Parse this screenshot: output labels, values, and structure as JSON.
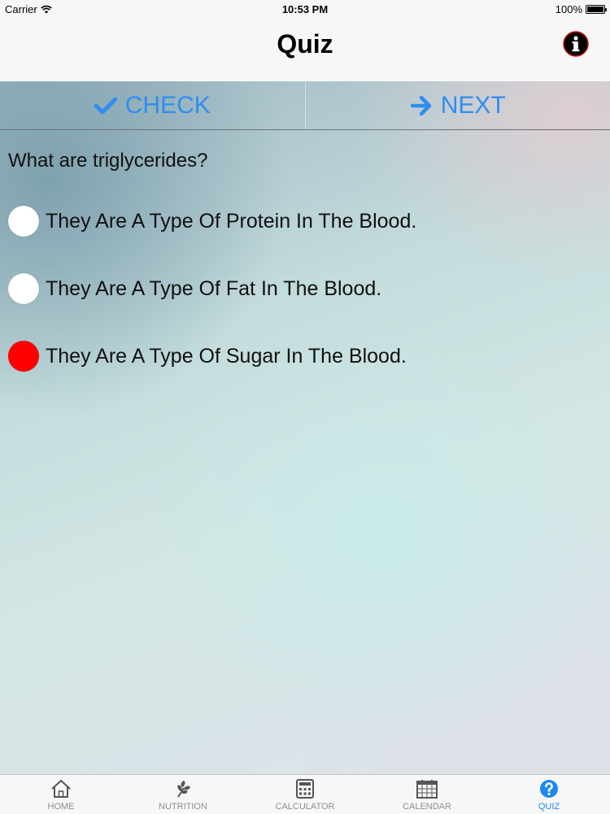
{
  "status_bar": {
    "carrier": "Carrier",
    "time": "10:53 PM",
    "battery": "100%"
  },
  "nav": {
    "title": "Quiz",
    "info_icon": "info-icon"
  },
  "actions": {
    "check_label": "CHECK",
    "next_label": "NEXT"
  },
  "question": "What are triglycerides?",
  "options": [
    {
      "label": "They Are A Type Of Protein In The Blood.",
      "selected": false
    },
    {
      "label": "They Are A Type Of Fat In The Blood.",
      "selected": false
    },
    {
      "label": "They Are A Type Of Sugar In The Blood.",
      "selected": true
    }
  ],
  "tabs": [
    {
      "label": "HOME",
      "icon": "home-icon",
      "active": false
    },
    {
      "label": "NUTRITION",
      "icon": "wheat-icon",
      "active": false
    },
    {
      "label": "CALCULATOR",
      "icon": "calculator-icon",
      "active": false
    },
    {
      "label": "CALENDAR",
      "icon": "calendar-icon",
      "active": false
    },
    {
      "label": "QUIZ",
      "icon": "question-icon",
      "active": true
    }
  ],
  "colors": {
    "accent": "#2e8ef0",
    "selected_radio": "#ff0000",
    "active_tab": "#1e88ef",
    "inactive_tab": "#8e8e93"
  }
}
